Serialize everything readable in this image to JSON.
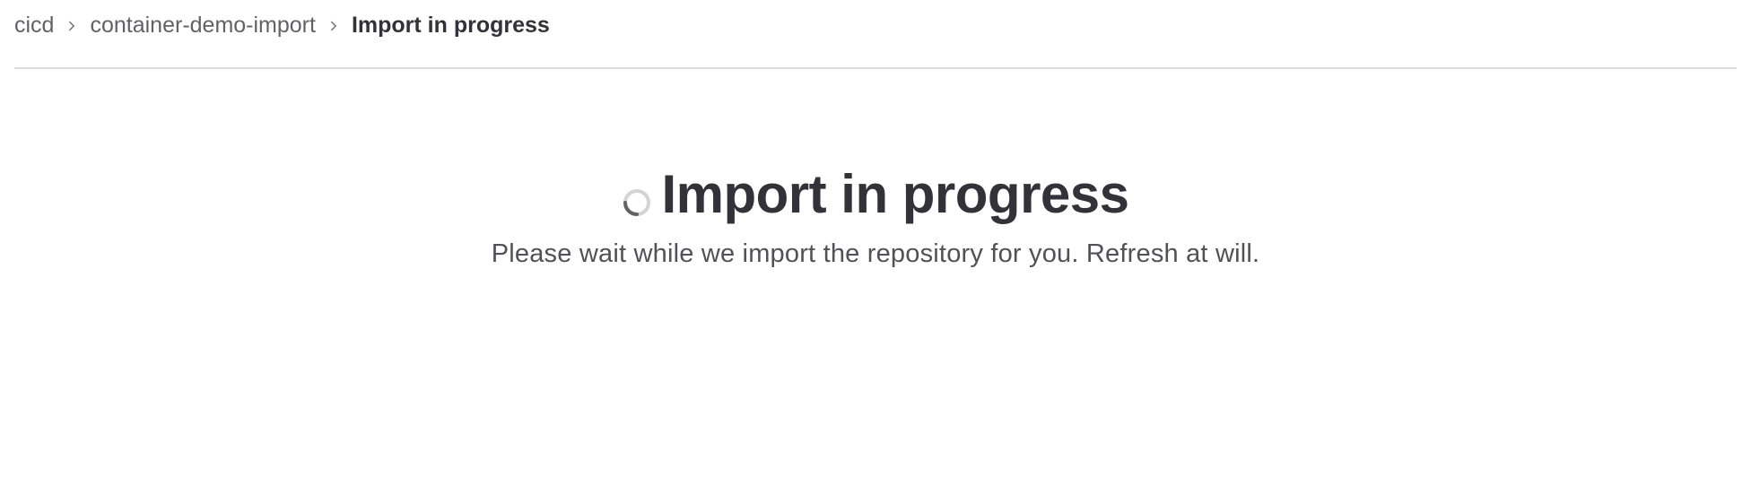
{
  "breadcrumb": {
    "items": [
      {
        "label": "cicd"
      },
      {
        "label": "container-demo-import"
      }
    ],
    "current": "Import in progress"
  },
  "main": {
    "title": "Import in progress",
    "subtitle": "Please wait while we import the repository for you. Refresh at will."
  },
  "icons": {
    "separator": "chevron-right-icon",
    "loading": "loading-spinner-icon"
  },
  "colors": {
    "text_primary": "#333238",
    "text_secondary": "#626168",
    "divider": "#dcdcde"
  }
}
